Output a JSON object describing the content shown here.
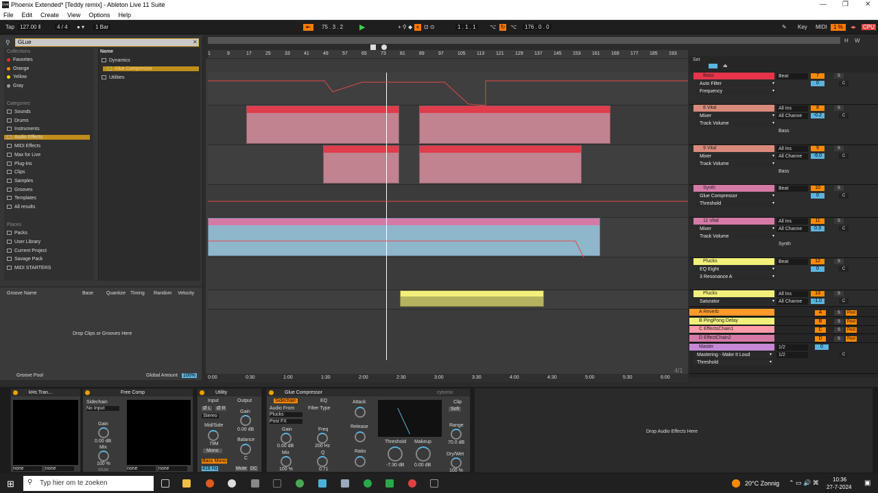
{
  "window": {
    "title": "Phoenix Extended* [Teddy remix] - Ableton Live 11 Suite"
  },
  "menu": [
    "File",
    "Edit",
    "Create",
    "View",
    "Options",
    "Help"
  ],
  "transport": {
    "tap": "Tap",
    "tempo": "127.00",
    "sig": "4 / 4",
    "quant": "1 Bar",
    "pos": "75 .  3 .  2",
    "loop_start": "1 .  1 .  1",
    "loop_len": "176 .  0 .  0",
    "key": "Key",
    "midi": "MIDI",
    "cpu": "1 %",
    "cpu_label": "CPU"
  },
  "browser": {
    "search": "GLue",
    "collections_title": "Collections",
    "collections": [
      {
        "label": "Favorites",
        "color": "#e03030"
      },
      {
        "label": "Orange",
        "color": "#ff8a00"
      },
      {
        "label": "Yellow",
        "color": "#f0e000"
      },
      {
        "label": "Gray",
        "color": "#9a9a9a"
      }
    ],
    "categories_title": "Categories",
    "categories": [
      "Sounds",
      "Drums",
      "Instruments",
      "Audio Effects",
      "MIDI Effects",
      "Max for Live",
      "Plug-Ins",
      "Clips",
      "Samples",
      "Grooves",
      "Templates",
      "All results"
    ],
    "places_title": "Places",
    "places": [
      "Packs",
      "User Library",
      "Current Project",
      "Savage Pack",
      "MIDI STARTERS"
    ],
    "name_header": "Name",
    "tree": [
      "Dynamics",
      "Glue Compressor",
      "Utilities"
    ]
  },
  "groove": {
    "cols": [
      "Groove Name",
      "Base",
      "Quantize",
      "Timing",
      "Random",
      "Velocity"
    ],
    "drop": "Drop Clips or Grooves Here",
    "pool": "Groove Pool",
    "global": "Global Amount",
    "global_val": "100%"
  },
  "ruler": [
    "1",
    "9",
    "17",
    "25",
    "33",
    "41",
    "49",
    "57",
    "65",
    "73",
    "81",
    "89",
    "97",
    "105",
    "113",
    "121",
    "129",
    "137",
    "145",
    "153",
    "161",
    "169",
    "177",
    "185",
    "193"
  ],
  "timeline": [
    "0:00",
    "0:30",
    "1:00",
    "1:30",
    "2:00",
    "2:30",
    "3:00",
    "3:30",
    "4:00",
    "4:30",
    "5:00",
    "5:30",
    "6:00"
  ],
  "page_fraction": "4/1",
  "mixer": {
    "set": "Set",
    "tracks": [
      {
        "name": "Bass",
        "color": "#e8344a",
        "device": "Auto Filter",
        "param": "Frequency",
        "io": "Beat",
        "num": "7",
        "vol": "0",
        "pan": "C",
        "extra": ""
      },
      {
        "name": "8 Vital",
        "color": "#d98a7a",
        "device": "Mixer",
        "param": "Track Volume",
        "io": "All Ins",
        "io2": "All Channe",
        "num": "8",
        "vol": "-0.2",
        "pan": "C",
        "extra": "Bass"
      },
      {
        "name": "9 Vital",
        "color": "#d98a7a",
        "device": "Mixer",
        "param": "Track Volume",
        "io": "All Ins",
        "io2": "All Channe",
        "num": "9",
        "vol": "-6.0",
        "pan": "C",
        "extra": "Bass"
      },
      {
        "name": "Synth",
        "color": "#d57aa6",
        "device": "Glue Compressor",
        "param": "Threshold",
        "io": "Beat",
        "num": "10",
        "vol": "0",
        "pan": "C",
        "extra": ""
      },
      {
        "name": "11 Vital",
        "color": "#d57aa6",
        "device": "Mixer",
        "param": "Track Volume",
        "io": "All Ins",
        "io2": "All Channe",
        "num": "11",
        "vol": "0.3",
        "pan": "C",
        "extra": "Synth"
      },
      {
        "name": "Plucks",
        "color": "#f2f07a",
        "device": "EQ Eight",
        "param": "3 Resonance A",
        "io": "Beat",
        "num": "12",
        "vol": "0",
        "pan": "C",
        "extra": ""
      },
      {
        "name": "Plucks",
        "color": "#f2f07a",
        "device": "Saturator",
        "param": "",
        "io": "All Ins",
        "io2": "All Channe",
        "num": "13",
        "vol": "-1.0",
        "pan": "C",
        "extra": ""
      }
    ],
    "returns": [
      {
        "name": "A Reverb",
        "color": "#ff9a2a",
        "l": "A"
      },
      {
        "name": "B PingPong Delay",
        "color": "#f2f07a",
        "l": "B"
      },
      {
        "name": "C EffectsChain1",
        "color": "#ff9aa8",
        "l": "C"
      },
      {
        "name": "D EffectChain2",
        "color": "#d57aa6",
        "l": "D"
      }
    ],
    "master": {
      "name": "Master",
      "device": "Mastering - Make It Loud",
      "param": "Threshold",
      "io": "1/2",
      "vol": "0",
      "pan": "C"
    },
    "labels": {
      "solo": "S",
      "in": "In",
      "auto": "Auto",
      "off": "Off",
      "inf": "-inf",
      "post": "Post"
    }
  },
  "devices": {
    "d1": {
      "name": "kHs Tran...",
      "sel1": "none",
      "sel2": "none"
    },
    "d2": {
      "name": "Free Comp",
      "sidechain": "Sidechain",
      "input": "No Input",
      "gain": "Gain",
      "gain_val": "0.00 dB",
      "mix": "Mix",
      "mix_val": "100 %",
      "mute": "Mute",
      "sel1": "none",
      "sel2": "none"
    },
    "util": {
      "name": "Utility",
      "input": "Input",
      "output": "Output",
      "l": "Ø L",
      "r": "Ø R",
      "stereo": "Stereo",
      "gain": "Gain",
      "gain_val": "0.00 dB",
      "midside": "Mid/Side",
      "ms_val": "79M",
      "mono": "Mono",
      "balance": "Balance",
      "bal_val": "C",
      "bass_mono": "Bass Mono",
      "bm_val": "418 Hz",
      "mute": "Mute",
      "dc": "DC"
    },
    "glue": {
      "name": "Glue Compressor",
      "sidechain": "Sidechain",
      "eq": "EQ",
      "audio_from": "Audio From",
      "src": "Plucks",
      "post": "Post FX",
      "filter": "Filter Type",
      "gain": "Gain",
      "gain_val": "0.00 dB",
      "freq": "Freq",
      "freq_val": "200 Hz",
      "mix": "Mix",
      "mix_val": "100 %",
      "q": "Q",
      "q_val": "0.71",
      "attack": "Attack",
      "release": "Release",
      "ratio": "Ratio",
      "threshold": "Threshold",
      "thr_val": "-7.30 dB",
      "makeup": "Makeup",
      "mk_val": "0.00 dB",
      "clip": "Clip",
      "soft": "Soft",
      "range": "Range",
      "range_val": "70.0 dB",
      "drywet": "Dry/Wet",
      "dw_val": "100 %",
      "brand": "cytomic"
    },
    "drop": "Drop Audio Effects Here"
  },
  "taskbar": {
    "search": "Typ hier om te zoeken",
    "weather": "20°C  Zonnig",
    "time": "10:36",
    "date": "27-7-2024"
  }
}
